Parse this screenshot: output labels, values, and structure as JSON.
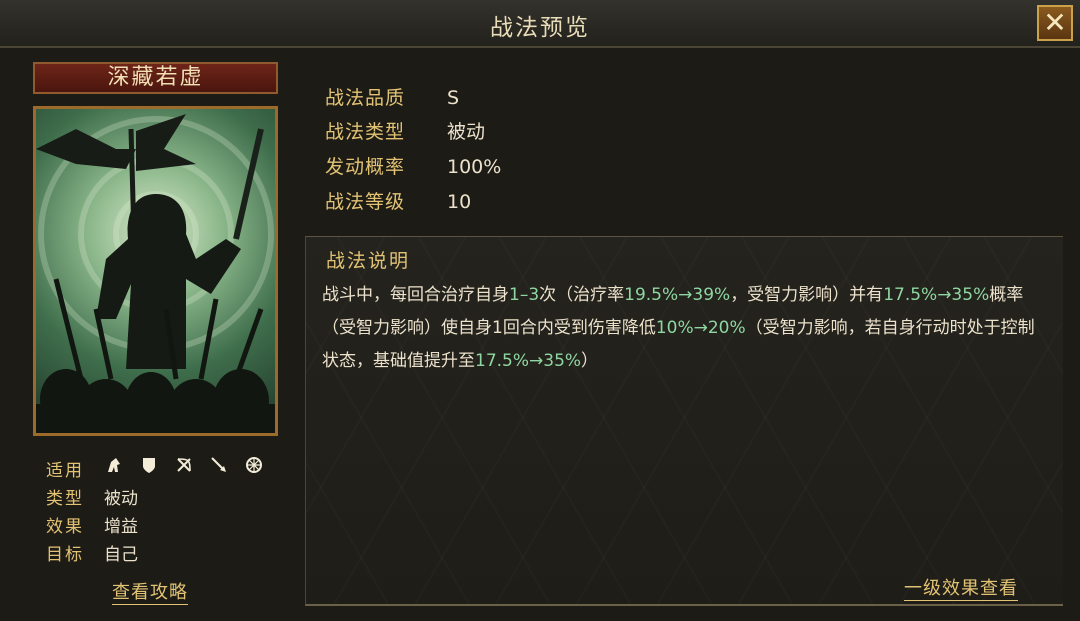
{
  "window": {
    "title": "战法预览",
    "close_label": "✕"
  },
  "skill": {
    "name": "深藏若虚",
    "meta": [
      {
        "key": "适用",
        "value": ""
      },
      {
        "key": "类型",
        "value": "被动"
      },
      {
        "key": "效果",
        "value": "增益"
      },
      {
        "key": "目标",
        "value": "自己"
      }
    ],
    "apply_icons": [
      "cavalry-icon",
      "shield-icon",
      "bow-icon",
      "spear-icon",
      "wheel-icon"
    ],
    "strategy_link": "查看攻略"
  },
  "attributes": [
    {
      "key": "战法品质",
      "value": "S"
    },
    {
      "key": "战法类型",
      "value": "被动"
    },
    {
      "key": "发动概率",
      "value": "100%"
    },
    {
      "key": "战法等级",
      "value": "10"
    }
  ],
  "description": {
    "title": "战法说明",
    "parts": [
      {
        "text": "战斗中，每回合治疗自身"
      },
      {
        "text": "1–3",
        "hl": true
      },
      {
        "text": "次（治疗率"
      },
      {
        "text": "19.5%→39%",
        "hl": true
      },
      {
        "text": "，受智力影响）并有"
      },
      {
        "text": "17.5%→35%",
        "hl": true
      },
      {
        "text": "概率（受智力影响）使自身1回合内受到伤害降低"
      },
      {
        "text": "10%→20%",
        "hl": true
      },
      {
        "text": "（受智力影响，若自身行动时处于控制状态，基础值提升至"
      },
      {
        "text": "17.5%→35%",
        "hl": true
      },
      {
        "text": "）"
      }
    ],
    "level_effect_link": "一级效果查看"
  },
  "colors": {
    "gold": "#e2c374",
    "highlight": "#8fd7a2",
    "text": "#ece2cc"
  }
}
